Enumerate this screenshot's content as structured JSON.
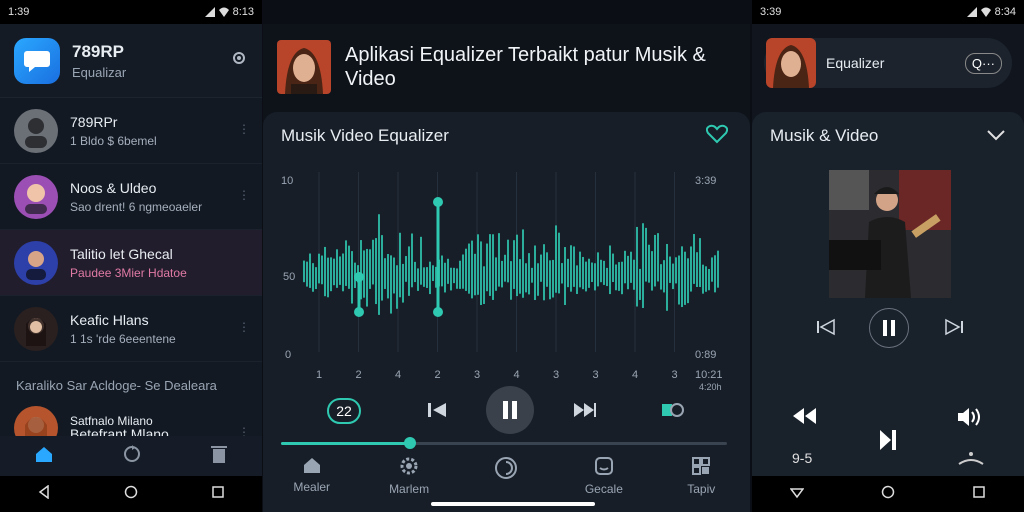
{
  "left": {
    "status": {
      "time": "1:39",
      "right": "8:13"
    },
    "app": {
      "title": "789RP",
      "subtitle": "Equalizar"
    },
    "chats": [
      {
        "name": "789RPr",
        "msg": "1 Bldo $ 6bemel",
        "msg_color": "normal"
      },
      {
        "name": "Noos & Uldeo",
        "msg": "Sao drent! 6 ngmeoaeler",
        "msg_color": "normal"
      },
      {
        "name": "Talitio let Ghecal",
        "msg": "Paudee 3Mier Hdatoe",
        "msg_color": "pink"
      },
      {
        "name": "Keafic Hlans",
        "msg": "1 1s 'rde 6eeentene",
        "msg_color": "normal"
      }
    ],
    "section_label": "Karaliko Sar Acldoge- Se Dealeara",
    "last_chat": {
      "name": "Betefrant Mlano",
      "sub": "Satfnalo Milano"
    },
    "tabs": [
      "home-icon",
      "refresh-icon",
      "trash-icon"
    ],
    "accent": "#2aa8ff"
  },
  "middle": {
    "title": "Aplikasi Equalizer Terbaikt patur Musik & Video",
    "card_title": "Musik Video  Equalizer",
    "chart_data": {
      "type": "bar",
      "y_ticks_left": [
        "10",
        "50",
        "0"
      ],
      "y_ticks_right": [
        "3:39",
        "0:89"
      ],
      "x_ticks": [
        "1",
        "2",
        "4",
        "2",
        "3",
        "4",
        "3",
        "3",
        "4",
        "3"
      ],
      "x_end_label": "10:21",
      "corner_label": "4:20h",
      "accent": "#2fc9b1"
    },
    "badge": "22",
    "progress": 0.29,
    "tabs": [
      {
        "icon": "home-icon",
        "label": "Mealer"
      },
      {
        "icon": "settings-icon",
        "label": "Marlem"
      },
      {
        "icon": "circle-icon",
        "label": ""
      },
      {
        "icon": "face-icon",
        "label": "Gecale"
      },
      {
        "icon": "grid-icon",
        "label": "Tapiv"
      }
    ]
  },
  "right": {
    "status": {
      "time": "3:39",
      "right": "8:34"
    },
    "header_title": "Equalizer",
    "search_text": "Q···",
    "card_title": "Musik & Video",
    "label_left": "9-5"
  }
}
